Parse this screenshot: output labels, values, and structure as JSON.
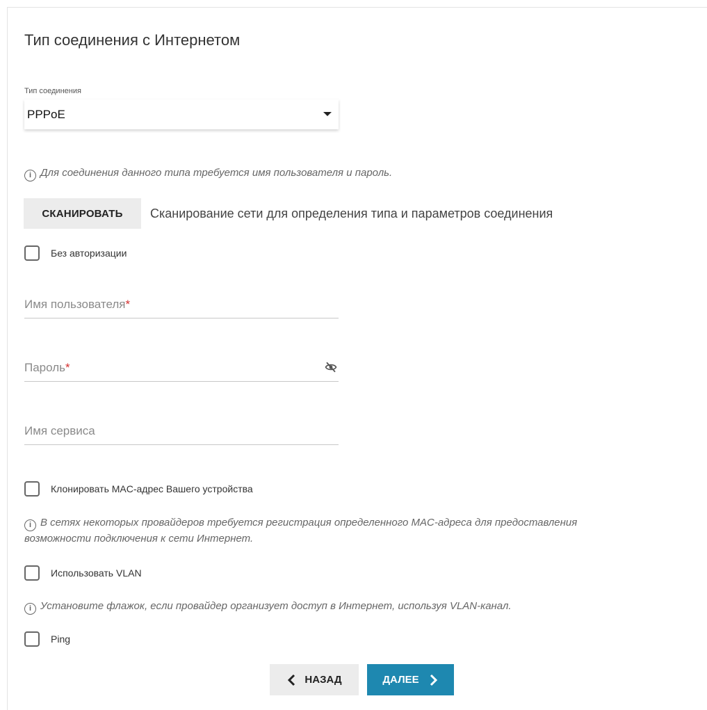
{
  "title": "Тип соединения с Интернетом",
  "connection": {
    "label": "Тип соединения",
    "value": "PPPoE"
  },
  "info_auth": "Для соединения данного типа требуется имя пользователя и пароль.",
  "scan": {
    "button_label": "СКАНИРОВАТЬ",
    "description": "Сканирование сети для определения типа и параметров соединения"
  },
  "no_auth": {
    "label": "Без авторизации",
    "checked": false
  },
  "username": {
    "placeholder": "Имя пользователя",
    "required_mark": "*"
  },
  "password": {
    "placeholder": "Пароль",
    "required_mark": "*",
    "icon": "eye-off-icon"
  },
  "service_name": {
    "placeholder": "Имя сервиса"
  },
  "clone_mac": {
    "label": "Клонировать MAC-адрес Вашего устройства",
    "checked": false
  },
  "info_mac_line1": "В сетях некоторых провайдеров требуется регистрация определенного MAC-адреса для предоставления",
  "info_mac_line2": "возможности подключения к сети Интернет.",
  "vlan": {
    "label": "Использовать VLAN",
    "checked": false
  },
  "info_vlan": "Установите флажок, если провайдер организует доступ в Интернет, используя VLAN-канал.",
  "ping": {
    "label": "Ping",
    "checked": false
  },
  "nav": {
    "back_label": "НАЗАД",
    "next_label": "ДАЛЕЕ"
  },
  "colors": {
    "primary": "#1e88b0",
    "required": "#d32f2f",
    "button_gray": "#ececec"
  }
}
